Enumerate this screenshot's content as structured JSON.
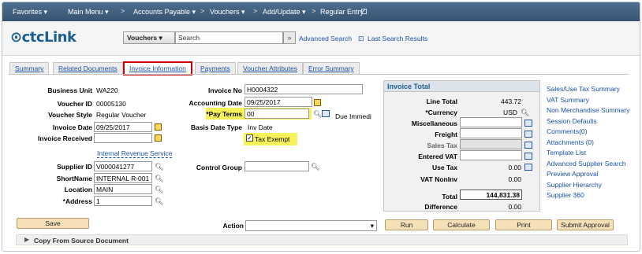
{
  "topnav": {
    "favorites": "Favorites ▾",
    "main_menu": "Main Menu ▾",
    "sep1": ">",
    "accounts_payable": "Accounts Payable ▾",
    "sep2": ">",
    "vouchers": "Vouchers ▾",
    "sep3": ">",
    "add_update": "Add/Update ▾",
    "sep4": ">",
    "regular_entry": "Regular Entry"
  },
  "header": {
    "logo": "ctcLink",
    "search_category": "Vouchers",
    "search_placeholder": "Search",
    "search_go": "»",
    "advanced_search": "Advanced Search",
    "last_search_results": "Last Search Results"
  },
  "tabs": [
    "Summary",
    "Related Documents",
    "Invoice Information",
    "Payments",
    "Voucher Attributes",
    "Error Summary"
  ],
  "left": {
    "business_unit_label": "Business Unit",
    "business_unit": "WA220",
    "voucher_id_label": "Voucher ID",
    "voucher_id": "00005130",
    "voucher_style_label": "Voucher Style",
    "voucher_style": "Regular Voucher",
    "invoice_date_label": "Invoice Date",
    "invoice_date": "09/25/2017",
    "invoice_received_label": "Invoice Received",
    "invoice_received": "",
    "irs_link": "Internal Revenue Service",
    "supplier_id_label": "Supplier ID",
    "supplier_id": "V000041277",
    "shortname_label": "ShortName",
    "shortname": "INTERNAL R-001",
    "location_label": "Location",
    "location": "MAIN",
    "address_label": "*Address",
    "address": "1"
  },
  "middle": {
    "invoice_no_label": "Invoice No",
    "invoice_no": "H0004322",
    "accounting_date_label": "Accounting Date",
    "accounting_date": "09/25/2017",
    "pay_terms_label": "*Pay Terms",
    "pay_terms": "00",
    "due_text": "Due Immedi",
    "basis_date_type_label": "Basis Date Type",
    "basis_date_type": "Inv Date",
    "tax_exempt_label": "Tax Exempt",
    "tax_exempt_checked": true,
    "control_group_label": "Control Group",
    "control_group": ""
  },
  "invoice_total": {
    "title": "Invoice Total",
    "line_total_label": "Line Total",
    "line_total": "443.72",
    "currency_label": "*Currency",
    "currency": "USD",
    "misc_label": "Miscellaneous",
    "freight_label": "Freight",
    "sales_tax_label": "Sales Tax",
    "entered_vat_label": "Entered VAT",
    "use_tax_label": "Use Tax",
    "use_tax": "0.00",
    "vat_noninv_label": "VAT NonInv",
    "vat_noninv": "0.00",
    "total_label": "Total",
    "total": "144,831.38",
    "difference_label": "Difference",
    "difference": "0.00"
  },
  "right_links": [
    "Sales/Use Tax Summary",
    "VAT Summary",
    "Non Merchandise Summary",
    "Session Defaults",
    "Comments(0)",
    "Attachments (0)",
    "Template List",
    "Advanced Supplier Search",
    "Preview Approval",
    "Supplier Hierarchy",
    "Supplier 360"
  ],
  "actions": {
    "save": "Save",
    "action_label": "Action",
    "run": "Run",
    "calculate": "Calculate",
    "print": "Print",
    "submit_approval": "Submit Approval"
  },
  "bottom": {
    "copy_from_source": "Copy From Source Document"
  }
}
